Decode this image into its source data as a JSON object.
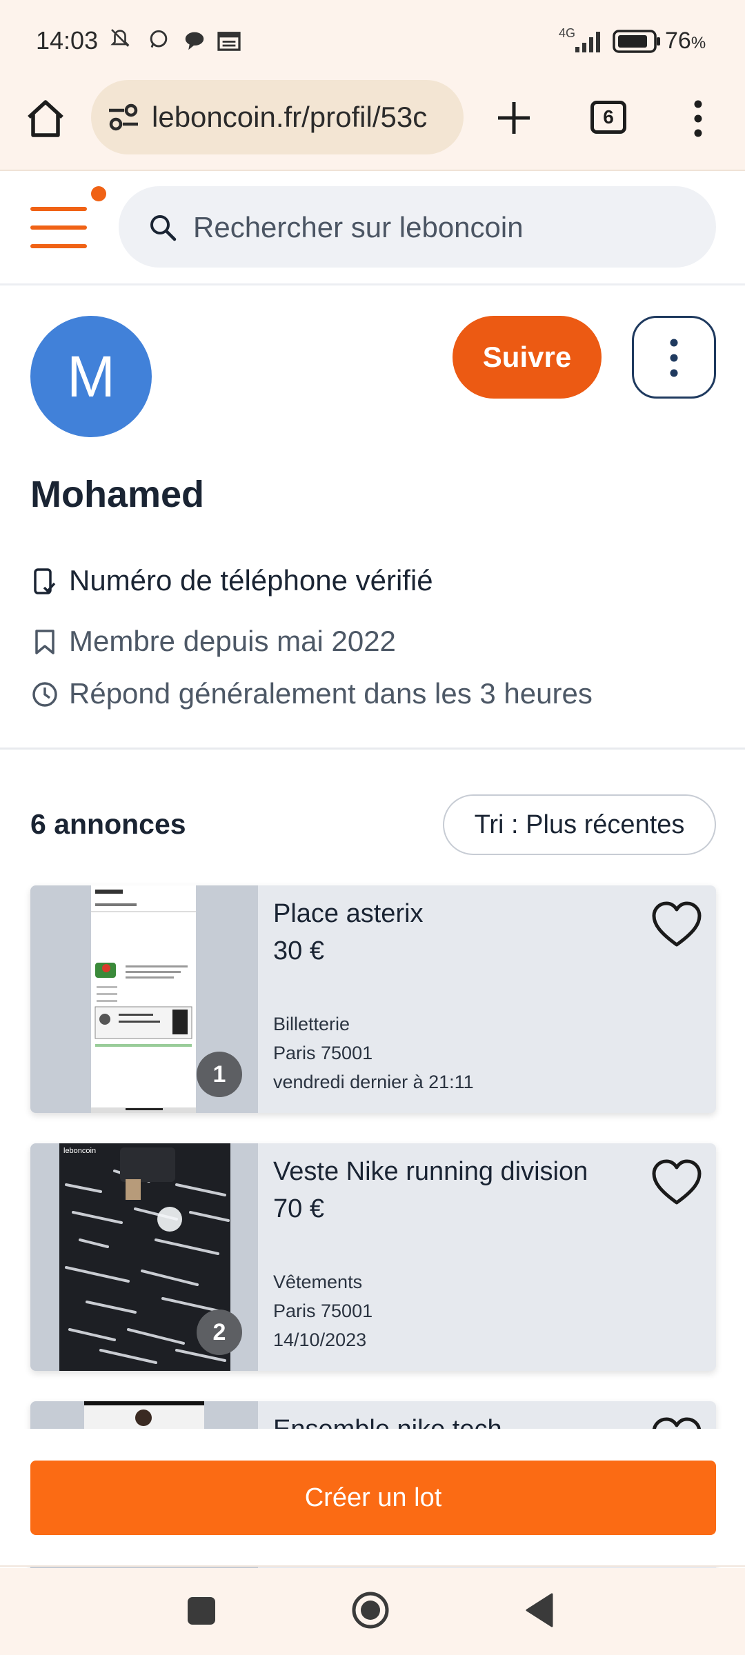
{
  "status_bar": {
    "time": "14:03",
    "network": "4G",
    "battery": "76",
    "battery_unit": "%",
    "icons": [
      "mute-icon",
      "whatsapp-icon",
      "chat-icon",
      "calendar-icon",
      "signal-icon",
      "battery-icon"
    ]
  },
  "browser": {
    "url": "leboncoin.fr/profil/53c",
    "tab_count": "6",
    "icons": [
      "home-icon",
      "site-settings-icon",
      "new-tab-icon",
      "tabs-icon",
      "menu-icon"
    ]
  },
  "header": {
    "search_placeholder": "Rechercher sur leboncoin",
    "accent_color": "#f06215"
  },
  "profile": {
    "avatar_initial": "M",
    "avatar_color": "#4181d9",
    "follow_label": "Suivre",
    "name": "Mohamed",
    "info": [
      {
        "icon": "phone-check-icon",
        "text": "Numéro de téléphone vérifié"
      },
      {
        "icon": "bookmark-icon",
        "text": "Membre depuis mai 2022"
      },
      {
        "icon": "clock-icon",
        "text": "Répond généralement dans les 3 heures"
      }
    ]
  },
  "listings": {
    "count_label": "6 annonces",
    "sort_label": "Tri : Plus récentes",
    "items": [
      {
        "title": "Place asterix",
        "price": "30 €",
        "category": "Billetterie",
        "location": "Paris 75001",
        "date": "vendredi dernier à 21:11",
        "photo_count": "1"
      },
      {
        "title": "Veste Nike running division",
        "price": "70 €",
        "category": "Vêtements",
        "location": "Paris 75001",
        "date": "14/10/2023",
        "photo_count": "2"
      },
      {
        "title": "Ensemble nike tech"
      }
    ]
  },
  "cta": {
    "label": "Créer un lot",
    "color": "#fb6b14"
  }
}
